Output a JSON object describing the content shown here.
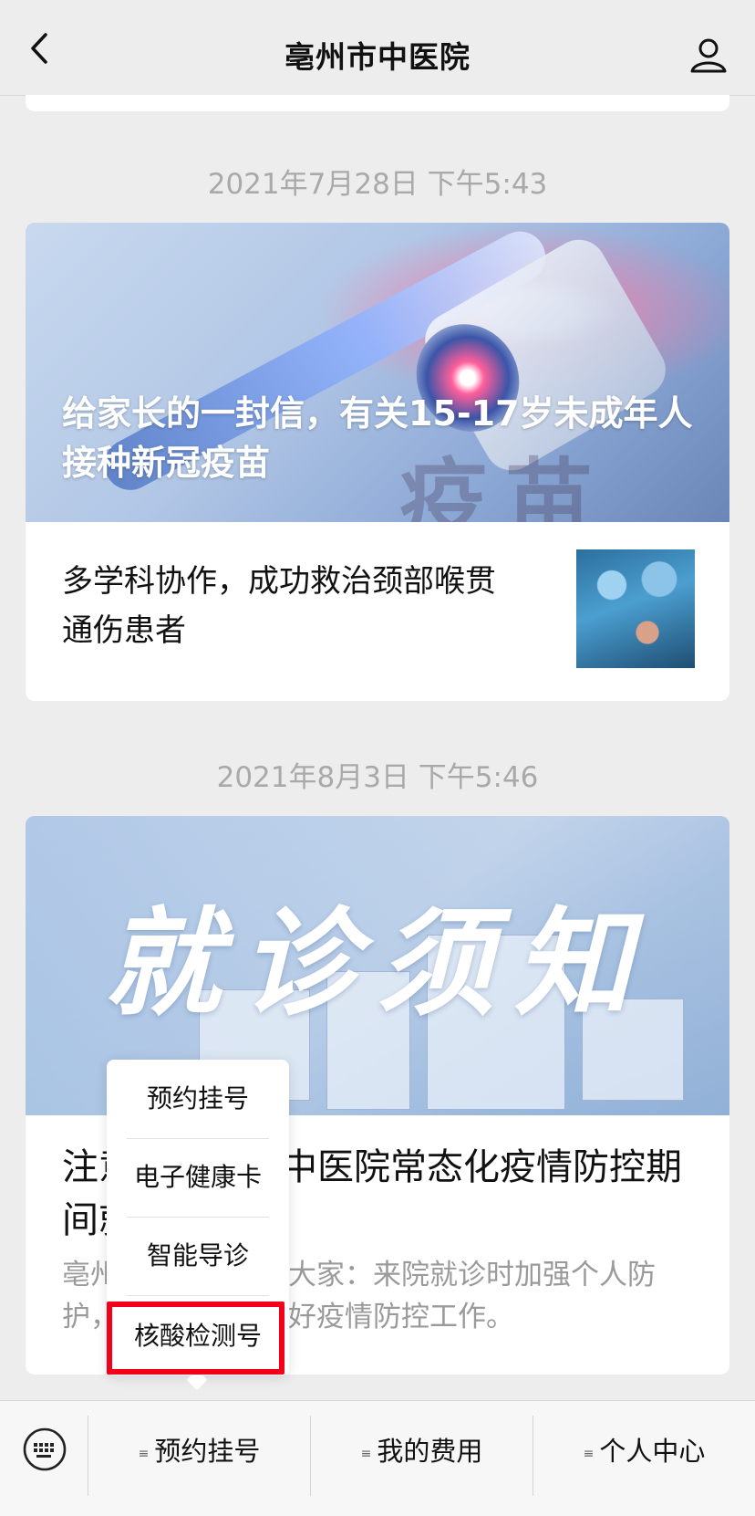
{
  "header": {
    "title": "亳州市中医院"
  },
  "feed": [
    {
      "time": "2021年7月28日 下午5:43",
      "cover_title": "给家长的一封信，有关15-17岁未成年人接种新冠疫苗",
      "cover_ghost": "疫苗",
      "item_title": "多学科协作，成功救治颈部喉贯通伤患者"
    },
    {
      "time": "2021年8月3日 下午5:46",
      "cover_title": "就诊须知",
      "title": "注意！亳州市中医院常态化疫情防控期间就诊须知",
      "desc": "亳州市中医院提醒大家：来院就诊时加强个人防护，与医院共同做好疫情防控工作。"
    }
  ],
  "popup_menu": {
    "items": [
      "预约挂号",
      "电子健康卡",
      "智能导诊",
      "核酸检测号"
    ]
  },
  "bottom_menu": {
    "items": [
      "预约挂号",
      "我的费用",
      "个人中心"
    ]
  },
  "colors": {
    "highlight": "#f4001b",
    "background": "#ededed"
  }
}
